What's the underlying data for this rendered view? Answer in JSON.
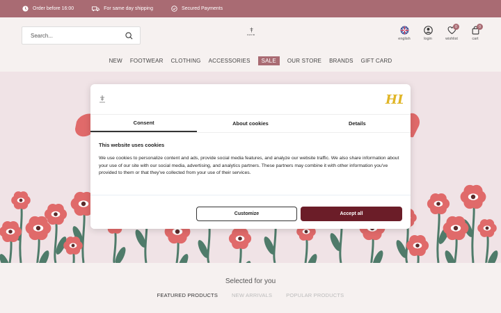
{
  "topbar": {
    "items": [
      {
        "icon": "clock-icon",
        "text": "Order before 16:00"
      },
      {
        "icon": "truck-icon",
        "text": "For same day shipping"
      },
      {
        "icon": "shield-check-icon",
        "text": "Secured Payments"
      }
    ]
  },
  "header": {
    "search_placeholder": "Search...",
    "logo_text": "DAVID",
    "icons": [
      {
        "icon": "uk-flag-icon",
        "label": "english"
      },
      {
        "icon": "user-icon",
        "label": "login"
      },
      {
        "icon": "heart-icon",
        "label": "wishlist",
        "badge": "0"
      },
      {
        "icon": "bag-icon",
        "label": "cart",
        "badge": "0"
      }
    ]
  },
  "nav": [
    "NEW",
    "FOOTWEAR",
    "CLOTHING",
    "ACCESSORIES",
    "SALE",
    "OUR STORE",
    "BRANDS",
    "GIFT CARD"
  ],
  "cookie": {
    "tabs": [
      "Consent",
      "About cookies",
      "Details"
    ],
    "title": "This website uses cookies",
    "body": "We use cookies to personalize content and ads, provide social media features, and analyze our website traffic. We also share information about your use of our site with our social media, advertising, and analytics partners. These partners may combine it with other information you've provided to them or that they've collected from your use of their services.",
    "customize_label": "Customize",
    "accept_label": "Accept all",
    "badge_text": "HL"
  },
  "section": {
    "title": "Selected for you",
    "tabs": [
      "FEATURED PRODUCTS",
      "NEW ARRIVALS",
      "POPULAR PRODUCTS"
    ]
  },
  "colors": {
    "topbar": "#a96b73",
    "accent": "#6b1d28",
    "hero_bg": "#f0e3e6",
    "flower": "#e06a6a",
    "stem": "#4f7b6a"
  }
}
